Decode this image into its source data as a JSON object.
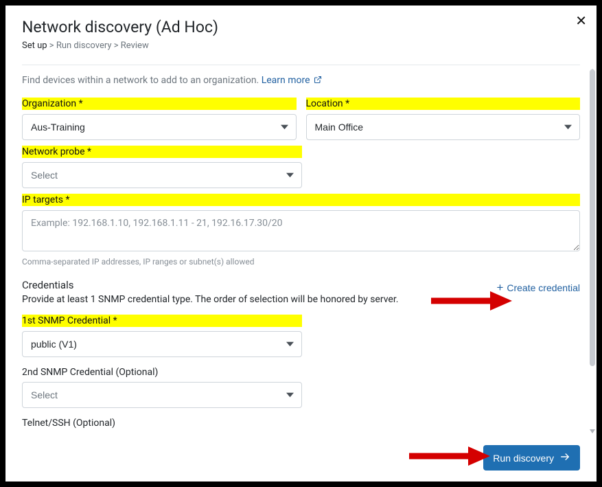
{
  "header": {
    "title": "Network discovery (Ad Hoc)",
    "breadcrumb": {
      "step1": "Set up",
      "step2": "Run discovery",
      "step3": "Review"
    }
  },
  "intro": {
    "text": "Find devices within a network to add to an organization. ",
    "learn_more": "Learn more"
  },
  "form": {
    "organization": {
      "label": "Organization *",
      "value": "Aus-Training"
    },
    "location": {
      "label": "Location *",
      "value": "Main Office"
    },
    "probe": {
      "label": "Network probe *",
      "value": "Select"
    },
    "ip": {
      "label": "IP targets *",
      "placeholder": "Example: 192.168.1.10, 192.168.1.11 - 21, 192.16.17.30/20",
      "hint": "Comma-separated IP addresses, IP ranges or subnet(s) allowed"
    }
  },
  "credentials": {
    "title": "Credentials",
    "desc": "Provide at least 1 SNMP credential type. The order of selection will be honored by server.",
    "create_label": "Create credential",
    "snmp1": {
      "label": "1st SNMP Credential *",
      "value": "public (V1)"
    },
    "snmp2": {
      "label": "2nd SNMP Credential (Optional)",
      "value": "Select"
    },
    "telnet": {
      "label": "Telnet/SSH (Optional)"
    }
  },
  "actions": {
    "run": "Run discovery"
  }
}
